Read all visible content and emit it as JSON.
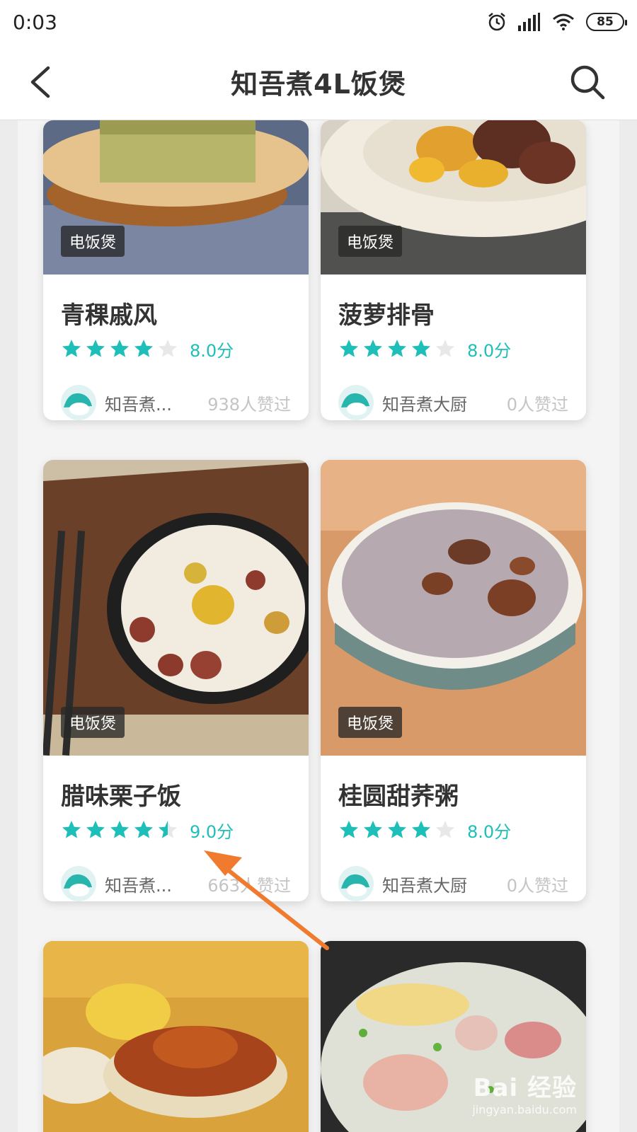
{
  "status": {
    "time": "0:03",
    "battery": "85"
  },
  "header": {
    "title": "知吾煮4L饭煲"
  },
  "cards": [
    {
      "tag": "电饭煲",
      "title": "青稞戚风",
      "score": "8.0分",
      "rating": 4,
      "author": "知吾煮...",
      "likes": "938人赞过"
    },
    {
      "tag": "电饭煲",
      "title": "菠萝排骨",
      "score": "8.0分",
      "rating": 4,
      "author": "知吾煮大厨",
      "likes": "0人赞过"
    },
    {
      "tag": "电饭煲",
      "title": "腊味栗子饭",
      "score": "9.0分",
      "rating": 4.5,
      "author": "知吾煮...",
      "likes": "663人赞过"
    },
    {
      "tag": "电饭煲",
      "title": "桂圆甜荞粥",
      "score": "8.0分",
      "rating": 4,
      "author": "知吾煮大厨",
      "likes": "0人赞过"
    }
  ],
  "colors": {
    "accent": "#1dbfb8",
    "star_empty": "#e8e8e8",
    "arrow": "#f07a2e"
  },
  "watermark": {
    "logo": "Bai 经验",
    "url": "jingyan.baidu.com"
  }
}
